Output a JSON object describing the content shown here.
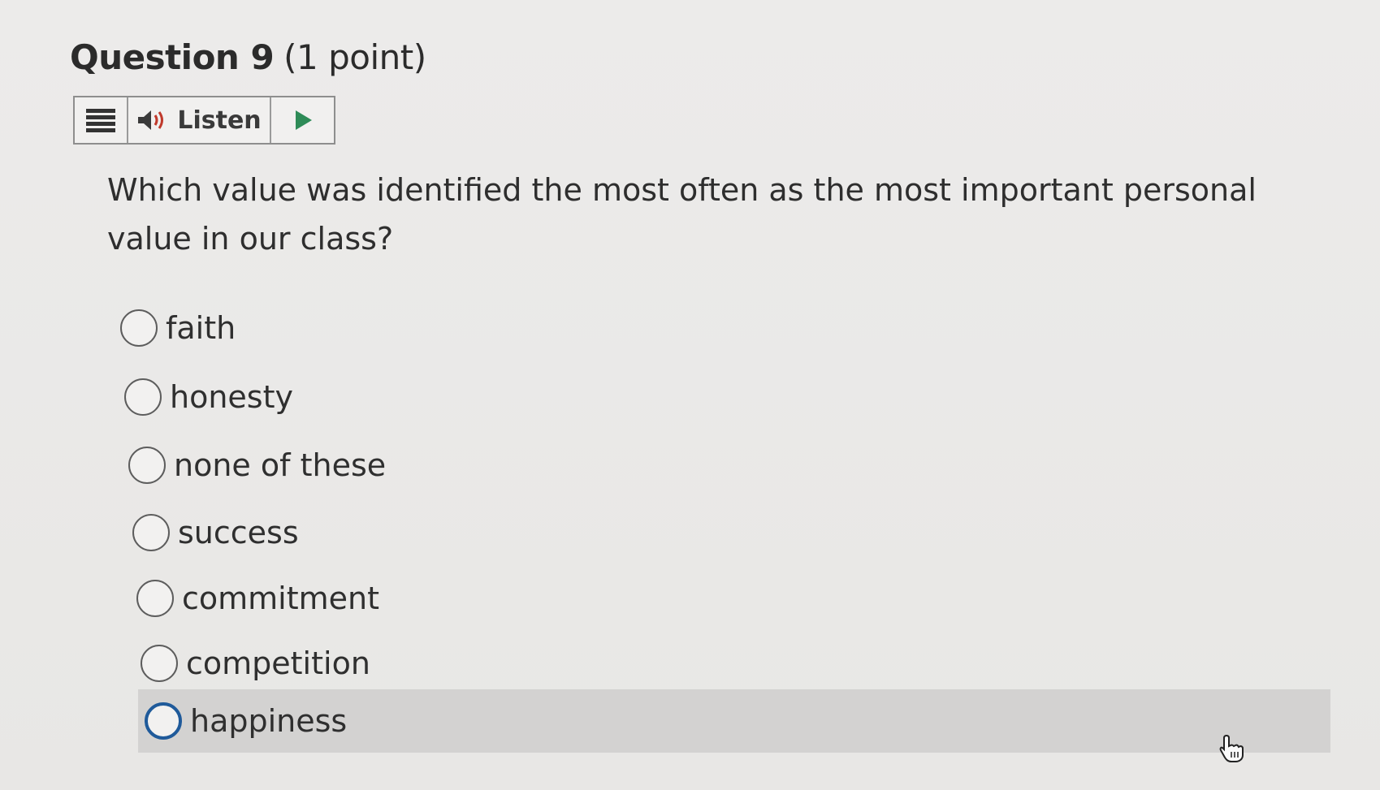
{
  "question": {
    "title": "Question 9",
    "points": "(1 point)",
    "text": "Which value was identified the most often as the most important personal value in our class?"
  },
  "toolbar": {
    "menu_icon": "hamburger-menu-icon",
    "listen_label": "Listen",
    "speaker_icon": "speaker-icon",
    "play_icon": "play-icon",
    "play_color": "#2e8b57"
  },
  "options": [
    {
      "label": "faith"
    },
    {
      "label": "honesty"
    },
    {
      "label": "none of these"
    },
    {
      "label": "success"
    },
    {
      "label": "commitment"
    },
    {
      "label": "competition"
    },
    {
      "label": "happiness"
    }
  ],
  "colors": {
    "background": "#ecebea",
    "hover_row": "#d3d2d1",
    "focus_ring": "#1f5a9a"
  }
}
